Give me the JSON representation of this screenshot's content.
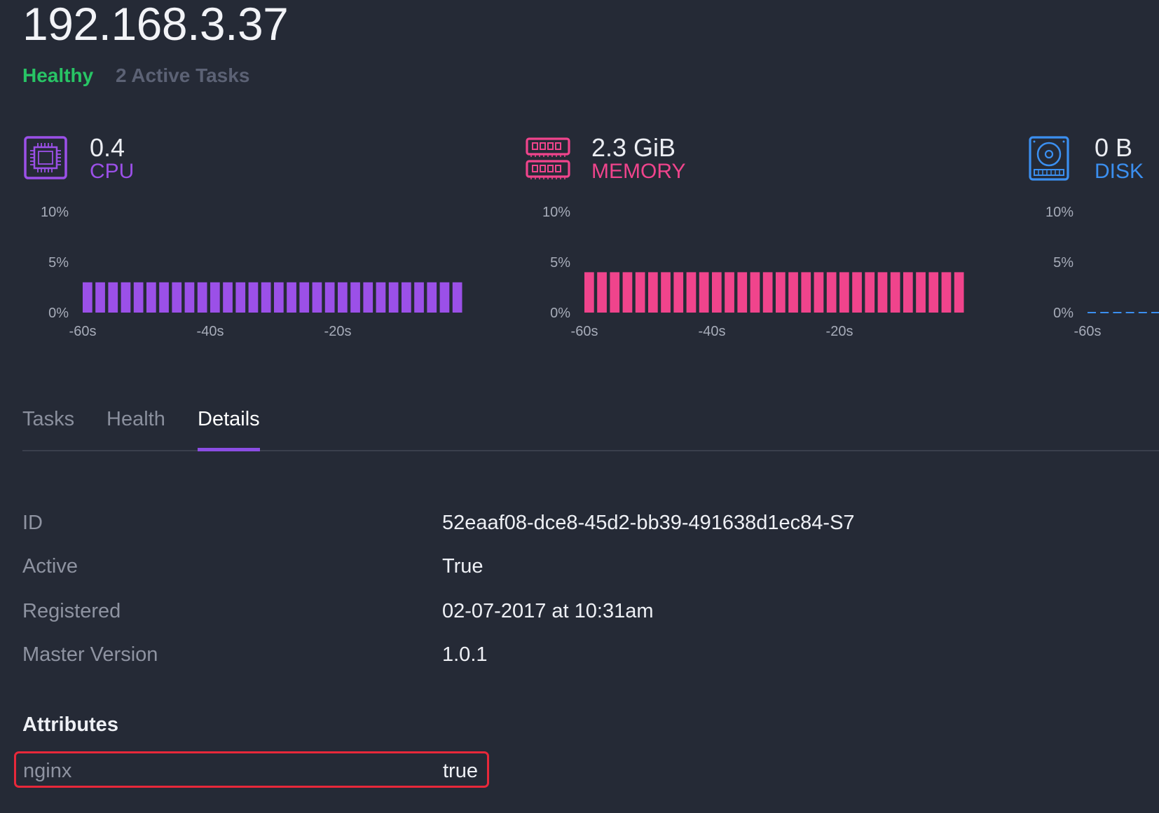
{
  "host": {
    "title": "192.168.3.37",
    "status": "Healthy",
    "tasks_summary": "2 Active Tasks"
  },
  "colors": {
    "healthy": "#28c465",
    "cpu": "#9b50e8",
    "memory": "#f0448c",
    "disk": "#3b8ff0"
  },
  "metrics": [
    {
      "key": "cpu",
      "value": "0.4",
      "label": "CPU",
      "icon": "cpu-chip-icon",
      "chart_data": {
        "type": "bar",
        "y_ticks": [
          "10%",
          "5%",
          "0%"
        ],
        "x_ticks": [
          "-60s",
          "-40s",
          "-20s"
        ],
        "ylim": [
          0,
          10
        ],
        "values": [
          3,
          3,
          3,
          3,
          3,
          3,
          3,
          3,
          3,
          3,
          3,
          3,
          3,
          3,
          3,
          3,
          3,
          3,
          3,
          3,
          3,
          3,
          3,
          3,
          3,
          3,
          3,
          3,
          3,
          3
        ]
      }
    },
    {
      "key": "memory",
      "value": "2.3 GiB",
      "label": "MEMORY",
      "icon": "memory-ram-icon",
      "chart_data": {
        "type": "bar",
        "y_ticks": [
          "10%",
          "5%",
          "0%"
        ],
        "x_ticks": [
          "-60s",
          "-40s",
          "-20s"
        ],
        "ylim": [
          0,
          10
        ],
        "values": [
          4,
          4,
          4,
          4,
          4,
          4,
          4,
          4,
          4,
          4,
          4,
          4,
          4,
          4,
          4,
          4,
          4,
          4,
          4,
          4,
          4,
          4,
          4,
          4,
          4,
          4,
          4,
          4,
          4,
          4
        ]
      }
    },
    {
      "key": "disk",
      "value": "0 B",
      "label": "DISK",
      "icon": "disk-drive-icon",
      "chart_data": {
        "type": "bar",
        "y_ticks": [
          "10%",
          "5%",
          "0%"
        ],
        "x_ticks": [
          "-60s"
        ],
        "ylim": [
          0,
          10
        ],
        "values": [
          0,
          0,
          0,
          0,
          0,
          0
        ]
      }
    }
  ],
  "tabs": [
    {
      "label": "Tasks",
      "active": false
    },
    {
      "label": "Health",
      "active": false
    },
    {
      "label": "Details",
      "active": true
    }
  ],
  "details": [
    {
      "label": "ID",
      "value": "52eaaf08-dce8-45d2-bb39-491638d1ec84-S7"
    },
    {
      "label": "Active",
      "value": "True"
    },
    {
      "label": "Registered",
      "value": "02-07-2017 at 10:31am"
    },
    {
      "label": "Master Version",
      "value": "1.0.1"
    }
  ],
  "attributes": {
    "heading": "Attributes",
    "items": [
      {
        "key": "nginx",
        "value": "true"
      }
    ]
  }
}
